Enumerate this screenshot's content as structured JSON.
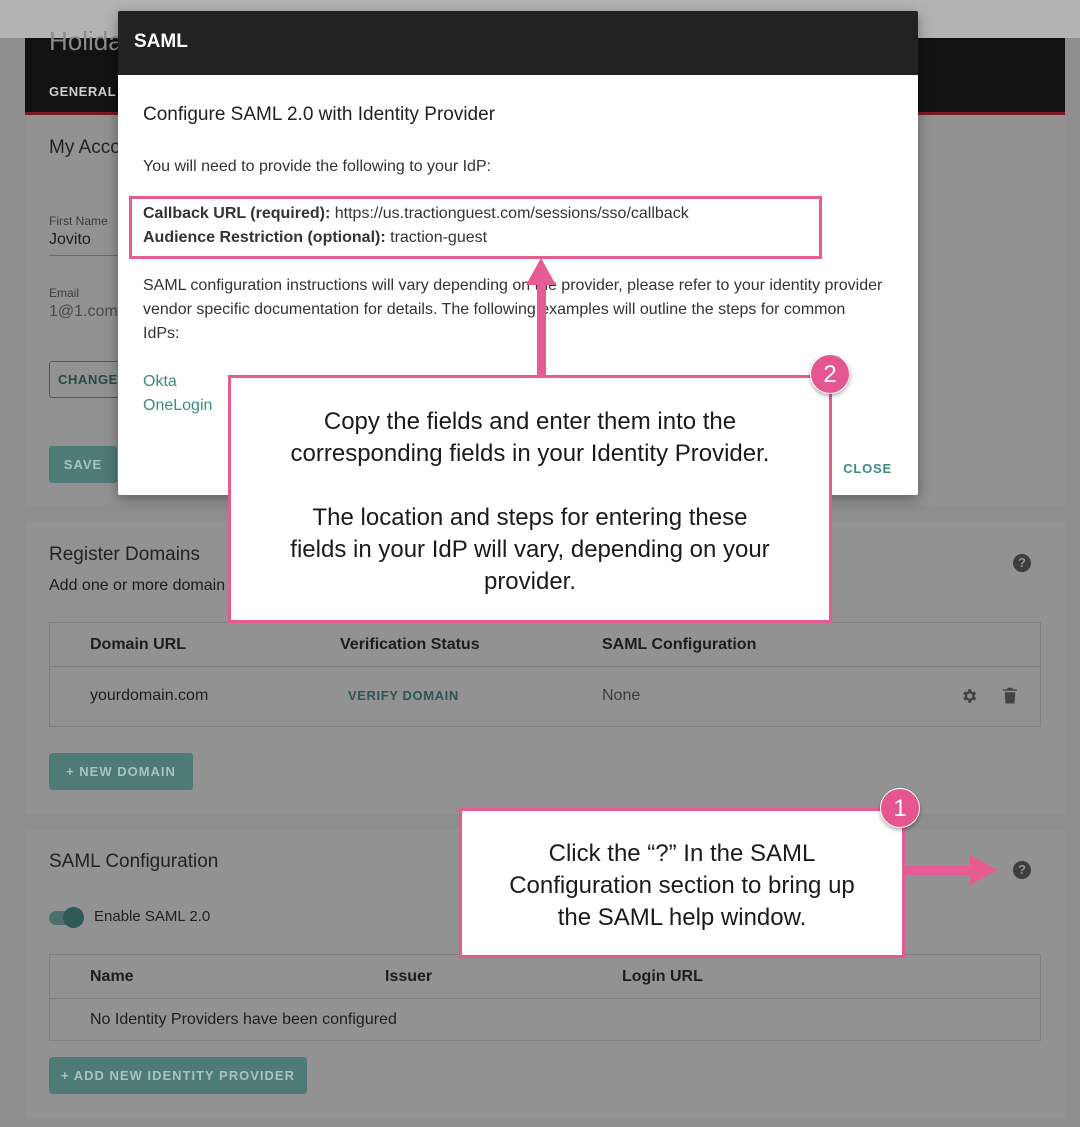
{
  "page": {
    "header_title": "Holida",
    "tab_general": "GENERAL"
  },
  "account": {
    "title": "My Acco",
    "first_name_label": "First Name",
    "first_name_value": "Jovito",
    "email_label": "Email",
    "email_value": "1@1.com",
    "change_button": "CHANGE",
    "save_button": "SAVE"
  },
  "domains": {
    "title": "Register Domains",
    "subtitle": "Add one or more domain",
    "columns": [
      "Domain URL",
      "Verification Status",
      "SAML Configuration"
    ],
    "rows": [
      {
        "url": "yourdomain.com",
        "status_action": "VERIFY DOMAIN",
        "saml": "None"
      }
    ],
    "new_domain_button": "+ NEW DOMAIN",
    "help_icon": "?"
  },
  "saml_config": {
    "title": "SAML Configuration",
    "toggle_label": "Enable SAML 2.0",
    "toggle_on": true,
    "columns": [
      "Name",
      "Issuer",
      "Login URL"
    ],
    "empty_message": "No Identity Providers have been configured",
    "add_provider_button": "+ ADD NEW IDENTITY PROVIDER",
    "help_icon": "?"
  },
  "modal": {
    "title": "SAML",
    "heading": "Configure SAML 2.0 with Identity Provider",
    "intro": "You will need to provide the following to your IdP:",
    "callback_label": "Callback URL (required):",
    "callback_value": "https://us.tractionguest.com/sessions/sso/callback",
    "audience_label": "Audience Restriction (optional):",
    "audience_value": "traction-guest",
    "instructions_line1": "SAML configuration instructions will vary depending on the provider, please refer to your identity provider",
    "instructions_line2": "vendor specific documentation for details. The following examples will outline the steps for common",
    "instructions_line3": "IdPs:",
    "link_okta": "Okta",
    "link_onelogin": "OneLogin",
    "close_button": "CLOSE"
  },
  "callouts": {
    "step2_badge": "2",
    "step2_line1": "Copy the fields and enter them into the",
    "step2_line2": "corresponding fields in your Identity Provider.",
    "step2_line3": "The location and steps for entering these",
    "step2_line4": "fields in your IdP will vary, depending on your",
    "step2_line5": "provider.",
    "step1_badge": "1",
    "step1_line1": "Click the “?” In the SAML",
    "step1_line2": "Configuration section to bring up",
    "step1_line3": "the SAML help window."
  },
  "colors": {
    "accent_pink": "#e55b92",
    "teal_link": "#3c8b84",
    "modal_header": "#222222"
  }
}
